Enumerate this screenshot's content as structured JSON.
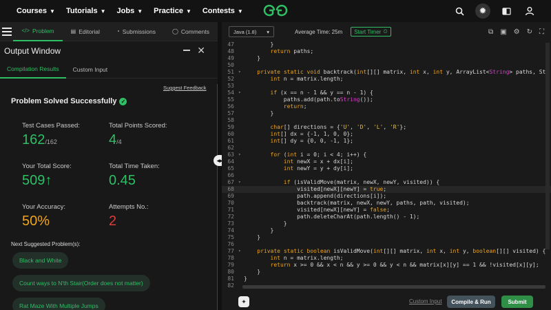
{
  "nav": {
    "items": [
      {
        "label": "Courses"
      },
      {
        "label": "Tutorials"
      },
      {
        "label": "Jobs"
      },
      {
        "label": "Practice"
      },
      {
        "label": "Contests"
      }
    ]
  },
  "problem_tabs": [
    {
      "label": "Problem",
      "icon": "code-icon"
    },
    {
      "label": "Editorial",
      "icon": "document-icon"
    },
    {
      "label": "Submissions",
      "icon": "history-icon"
    },
    {
      "label": "Comments",
      "icon": "chat-icon"
    }
  ],
  "output": {
    "title": "Output Window",
    "tabs": [
      {
        "label": "Compilation Results"
      },
      {
        "label": "Custom Input"
      }
    ],
    "feedback": "Suggest Feedback",
    "solved": "Problem Solved Successfully",
    "stats": {
      "passed_label": "Test Cases Passed:",
      "passed_value": "162",
      "passed_total": "/162",
      "points_label": "Total Points Scored:",
      "points_value": "4",
      "points_total": "/4",
      "score_label": "Your Total Score:",
      "score_value": "509",
      "time_label": "Total Time Taken:",
      "time_value": "0.45",
      "accuracy_label": "Your Accuracy:",
      "accuracy_value": "50%",
      "attempts_label": "Attempts No.:",
      "attempts_value": "2"
    },
    "next_label": "Next Suggested Problem(s):",
    "suggestions": [
      {
        "label": "Black and White"
      },
      {
        "label": "Count ways to N'th Stair(Order does not matter)"
      },
      {
        "label": "Rat Maze With Multiple Jumps"
      }
    ]
  },
  "editor": {
    "language": "Java (1.8)",
    "avg_time": "Average Time: 25m",
    "timer_label": "Start Timer",
    "custom_input": "Custom Input",
    "compile_label": "Compile & Run",
    "submit_label": "Submit",
    "lines": [
      {
        "n": "47",
        "fold": "",
        "code": "        }"
      },
      {
        "n": "48",
        "fold": "",
        "code": "        return paths;"
      },
      {
        "n": "49",
        "fold": "",
        "code": "    }"
      },
      {
        "n": "50",
        "fold": "",
        "code": ""
      },
      {
        "n": "51",
        "fold": "▾",
        "code": "    private static void backtrack(int[][] matrix, int x, int y, ArrayList<String> paths, Str"
      },
      {
        "n": "52",
        "fold": "",
        "code": "        int n = matrix.length;"
      },
      {
        "n": "53",
        "fold": "",
        "code": ""
      },
      {
        "n": "54",
        "fold": "▾",
        "code": "        if (x == n - 1 && y == n - 1) {"
      },
      {
        "n": "55",
        "fold": "",
        "code": "            paths.add(path.toString());"
      },
      {
        "n": "56",
        "fold": "",
        "code": "            return;"
      },
      {
        "n": "57",
        "fold": "",
        "code": "        }"
      },
      {
        "n": "58",
        "fold": "",
        "code": ""
      },
      {
        "n": "59",
        "fold": "",
        "code": "        char[] directions = {'U', 'D', 'L', 'R'};"
      },
      {
        "n": "60",
        "fold": "",
        "code": "        int[] dx = {-1, 1, 0, 0};"
      },
      {
        "n": "61",
        "fold": "",
        "code": "        int[] dy = {0, 0, -1, 1};"
      },
      {
        "n": "62",
        "fold": "",
        "code": ""
      },
      {
        "n": "63",
        "fold": "▾",
        "code": "        for (int i = 0; i < 4; i++) {"
      },
      {
        "n": "64",
        "fold": "",
        "code": "            int newX = x + dx[i];"
      },
      {
        "n": "65",
        "fold": "",
        "code": "            int newY = y + dy[i];"
      },
      {
        "n": "66",
        "fold": "",
        "code": ""
      },
      {
        "n": "67",
        "fold": "▾",
        "code": "            if (isValidMove(matrix, newX, newY, visited)) {"
      },
      {
        "n": "68",
        "fold": "",
        "code": "                visited[newX][newY] = true;"
      },
      {
        "n": "69",
        "fold": "",
        "code": "                path.append(directions[i]);"
      },
      {
        "n": "70",
        "fold": "",
        "code": "                backtrack(matrix, newX, newY, paths, path, visited);"
      },
      {
        "n": "71",
        "fold": "",
        "code": "                visited[newX][newY] = false;"
      },
      {
        "n": "72",
        "fold": "",
        "code": "                path.deleteCharAt(path.length() - 1);"
      },
      {
        "n": "73",
        "fold": "",
        "code": "            }"
      },
      {
        "n": "74",
        "fold": "",
        "code": "        }"
      },
      {
        "n": "75",
        "fold": "",
        "code": "    }"
      },
      {
        "n": "76",
        "fold": "",
        "code": ""
      },
      {
        "n": "77",
        "fold": "▾",
        "code": "    private static boolean isValidMove(int[][] matrix, int x, int y, boolean[][] visited) {"
      },
      {
        "n": "78",
        "fold": "",
        "code": "        int n = matrix.length;"
      },
      {
        "n": "79",
        "fold": "",
        "code": "        return x >= 0 && x < n && y >= 0 && y < n && matrix[x][y] == 1 && !visited[x][y];"
      },
      {
        "n": "80",
        "fold": "",
        "code": "    }"
      },
      {
        "n": "81",
        "fold": "",
        "code": "}"
      },
      {
        "n": "82",
        "fold": "",
        "code": ""
      }
    ]
  },
  "colors": {
    "accent": "#2fbf65",
    "orange": "#f0a51e",
    "red": "#e03b3b",
    "submit": "#2f8f46"
  }
}
